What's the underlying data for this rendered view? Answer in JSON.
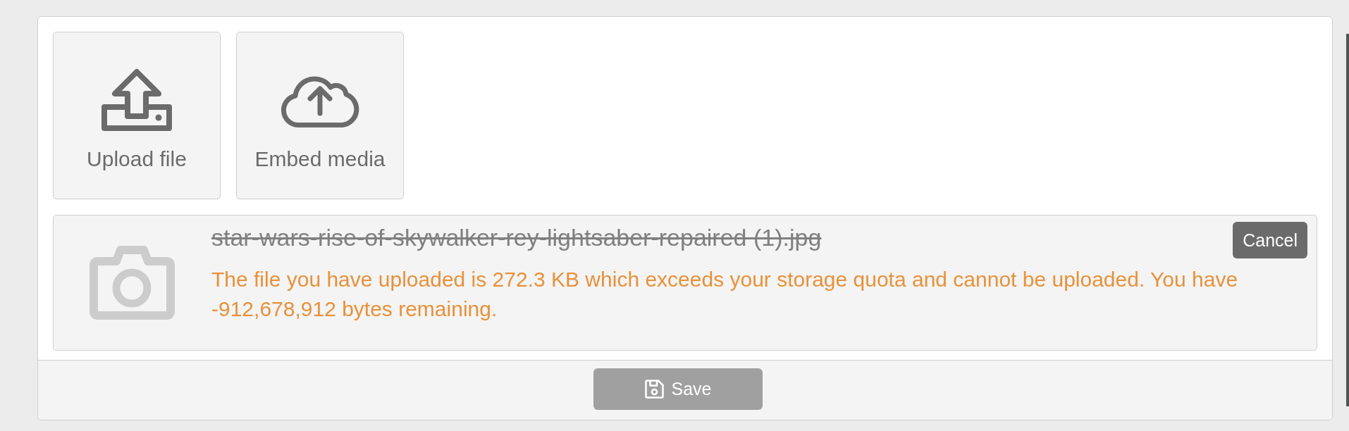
{
  "upload_options": [
    {
      "kind": "upload",
      "label": "Upload file"
    },
    {
      "kind": "embed",
      "label": "Embed media"
    }
  ],
  "file": {
    "name": "star-wars-rise-of-skywalker-rey-lightsaber-repaired (1).jpg",
    "rejected": true,
    "error": "The file you have uploaded is 272.3 KB which exceeds your storage quota and cannot be uploaded. You have -912,678,912 bytes remaining.",
    "cancel_label": "Cancel"
  },
  "footer": {
    "save_label": "Save",
    "save_disabled": true
  }
}
